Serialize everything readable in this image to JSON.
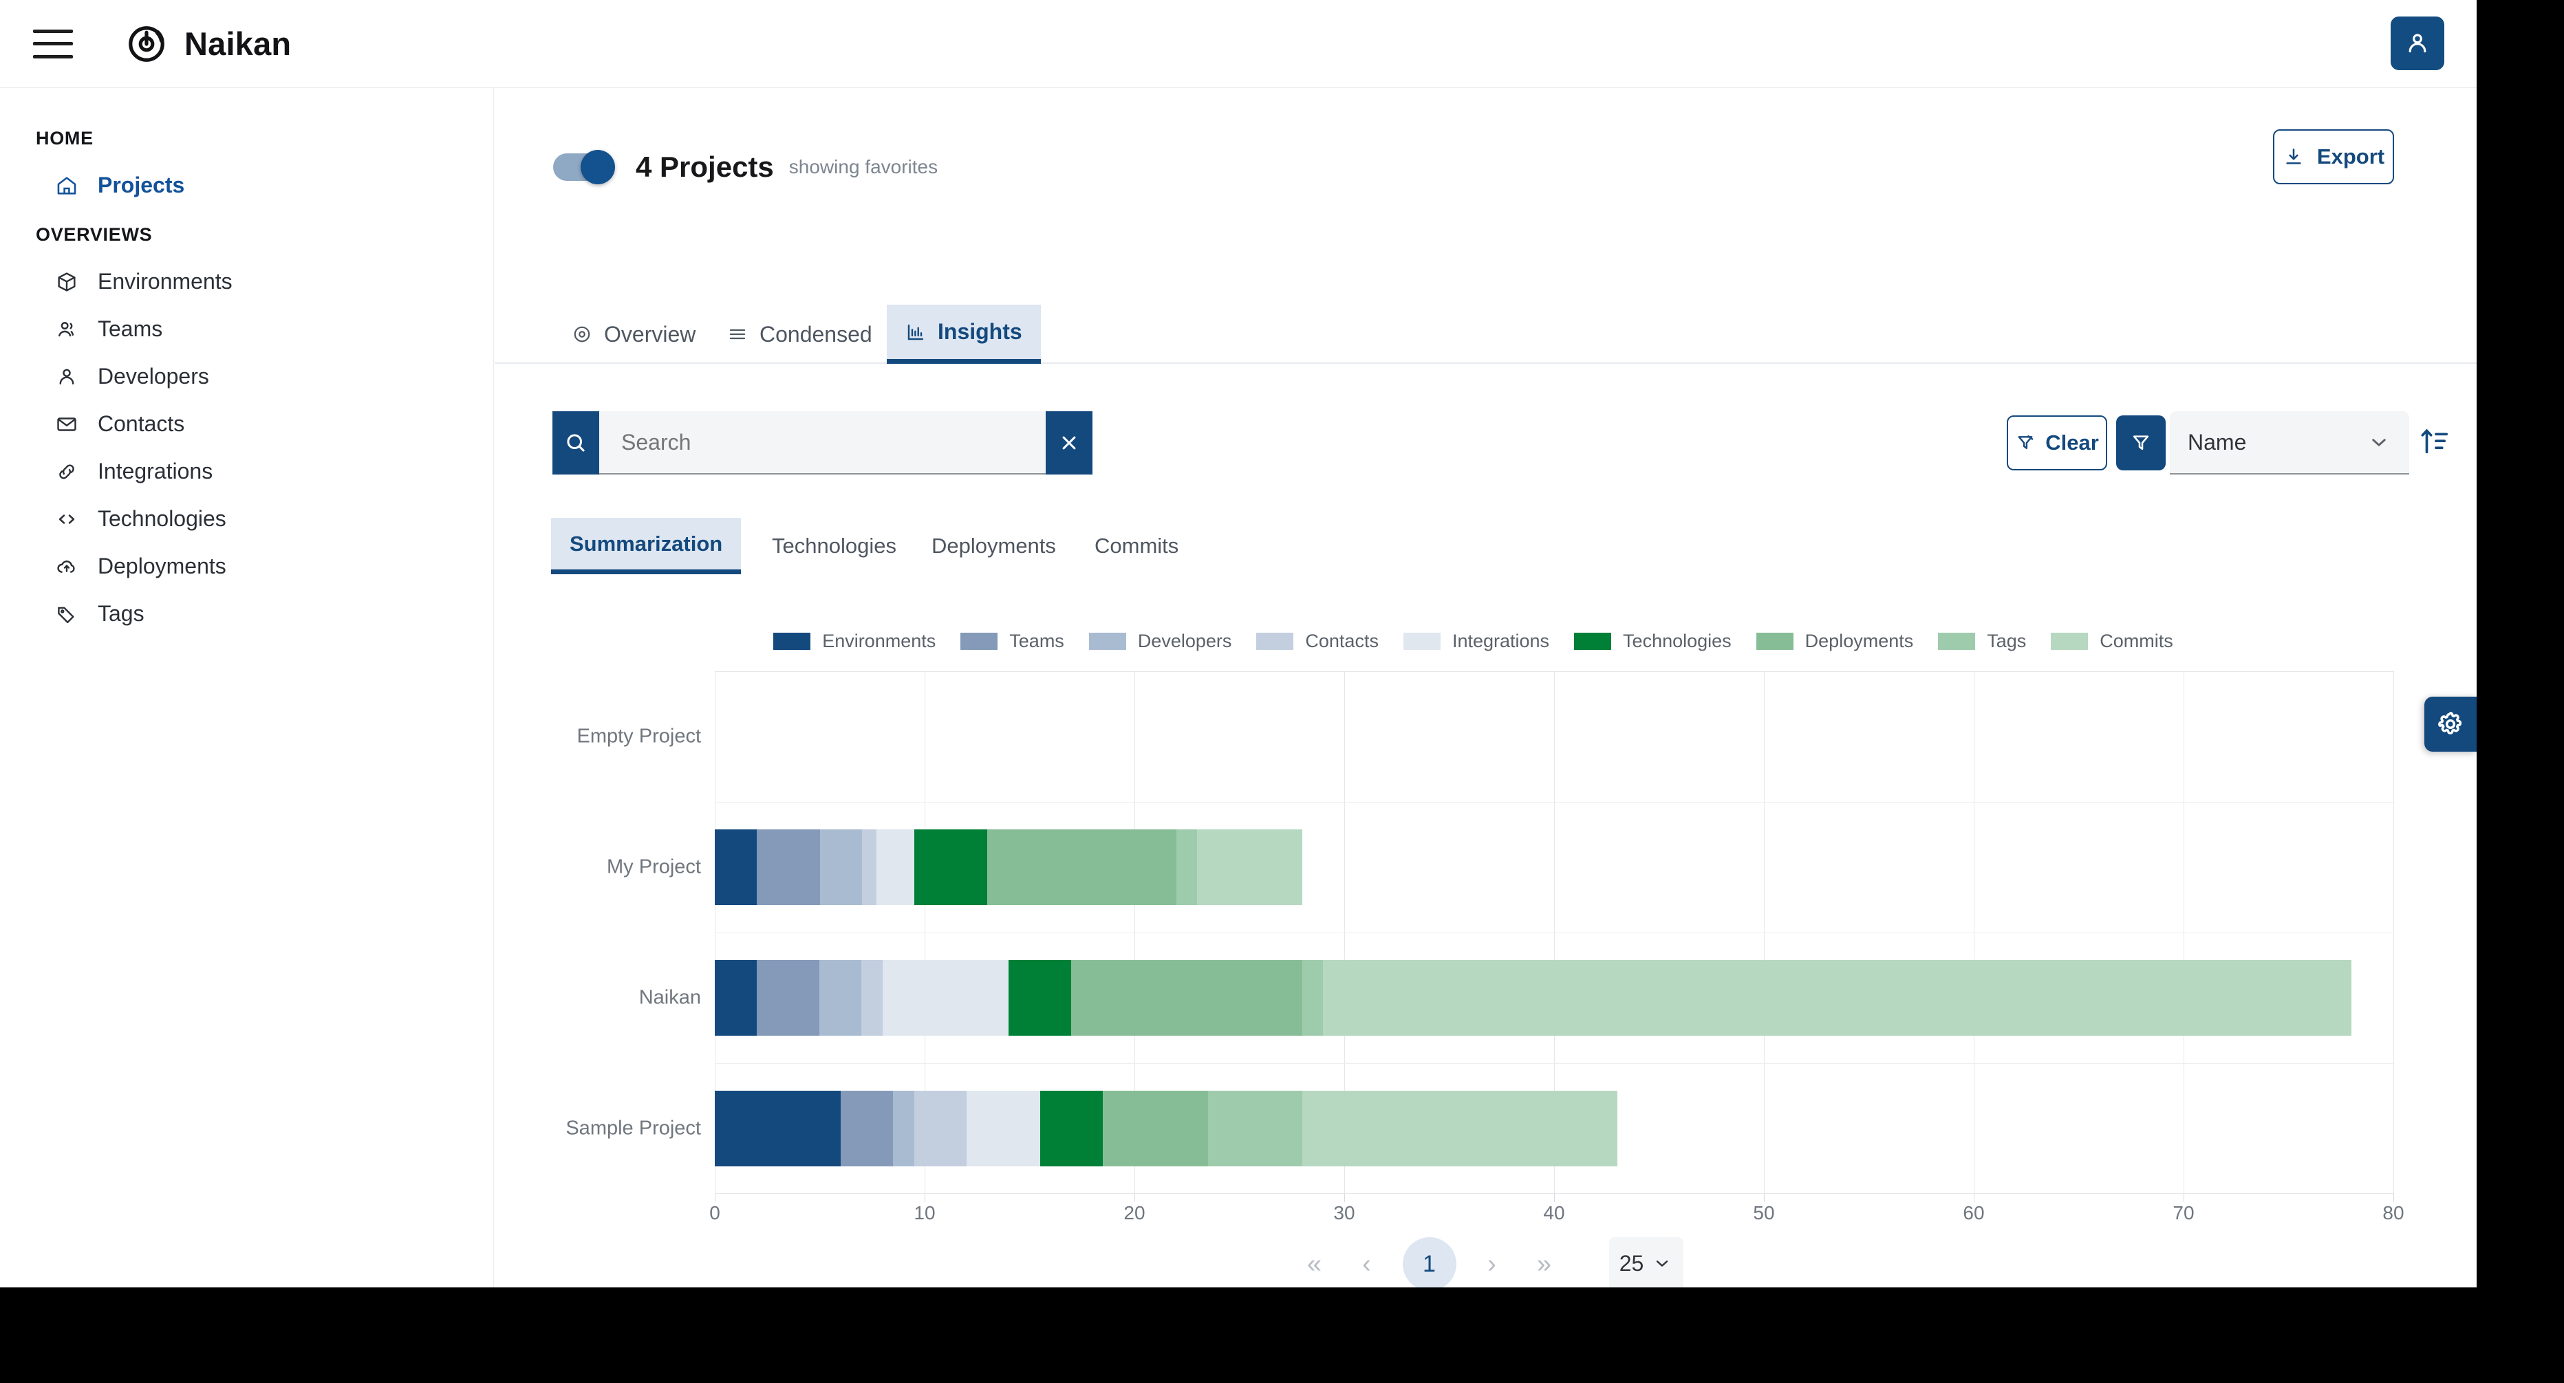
{
  "app": {
    "brand_name": "Naikan",
    "menu_icon": "hamburger-icon",
    "logo_icon": "naikan-logo-icon",
    "avatar_icon": "user-icon"
  },
  "sidebar": {
    "sections": [
      {
        "title": "HOME",
        "items": [
          {
            "label": "Projects",
            "icon": "home-icon",
            "active": true
          }
        ]
      },
      {
        "title": "OVERVIEWS",
        "items": [
          {
            "label": "Environments",
            "icon": "box-icon",
            "active": false
          },
          {
            "label": "Teams",
            "icon": "users-icon",
            "active": false
          },
          {
            "label": "Developers",
            "icon": "user-icon",
            "active": false
          },
          {
            "label": "Contacts",
            "icon": "mail-icon",
            "active": false
          },
          {
            "label": "Integrations",
            "icon": "link-icon",
            "active": false
          },
          {
            "label": "Technologies",
            "icon": "code-icon",
            "active": false
          },
          {
            "label": "Deployments",
            "icon": "cloud-upload-icon",
            "active": false
          },
          {
            "label": "Tags",
            "icon": "tag-icon",
            "active": false
          }
        ]
      }
    ]
  },
  "header": {
    "favorites_toggle_on": true,
    "title": "4 Projects",
    "subtitle": "showing favorites",
    "export_label": "Export",
    "export_icon": "download-icon"
  },
  "view_tabs": [
    {
      "label": "Overview",
      "icon": "eye-icon",
      "active": false
    },
    {
      "label": "Condensed",
      "icon": "list-icon",
      "active": false
    },
    {
      "label": "Insights",
      "icon": "bar-chart-icon",
      "active": true
    }
  ],
  "search": {
    "value": "",
    "placeholder": "Search",
    "search_icon": "search-icon",
    "clear_icon": "close-icon"
  },
  "controls": {
    "clear_label": "Clear",
    "clear_icon": "filter-off-icon",
    "filter_icon": "filter-icon",
    "sort_value": "Name",
    "sort_chevron_icon": "chevron-down-icon",
    "sort_direction_icon": "sort-ascending-icon"
  },
  "sub_tabs": [
    {
      "label": "Summarization",
      "active": true
    },
    {
      "label": "Technologies",
      "active": false
    },
    {
      "label": "Deployments",
      "active": false
    },
    {
      "label": "Commits",
      "active": false
    }
  ],
  "pagination": {
    "first_icon": "chevrons-left-icon",
    "prev_icon": "chevron-left-icon",
    "current_page": "1",
    "next_icon": "chevron-right-icon",
    "last_icon": "chevrons-right-icon",
    "page_size": "25",
    "page_size_chevron_icon": "chevron-down-icon"
  },
  "settings_fab": {
    "icon": "gear-icon"
  },
  "colors": {
    "primary": "#14497e",
    "accent_light": "#dde6f1",
    "surface": "#f4f5f6",
    "text": "#30343a",
    "muted": "#70767e"
  },
  "chart_data": {
    "type": "bar",
    "orientation": "horizontal",
    "stacked": true,
    "title": "",
    "xlabel": "",
    "ylabel": "",
    "xlim": [
      0,
      80
    ],
    "xticks": [
      0,
      10,
      20,
      30,
      40,
      50,
      60,
      70,
      80
    ],
    "grid": true,
    "legend_position": "top",
    "categories": [
      "Empty Project",
      "My Project",
      "Naikan",
      "Sample Project"
    ],
    "series": [
      {
        "name": "Environments",
        "color": "#14497e",
        "values": [
          0,
          2,
          2,
          6
        ]
      },
      {
        "name": "Teams",
        "color": "#849ab8",
        "values": [
          0,
          3,
          3,
          2.5
        ]
      },
      {
        "name": "Developers",
        "color": "#a9bbd1",
        "values": [
          0,
          2,
          2,
          1
        ]
      },
      {
        "name": "Contacts",
        "color": "#c3cfdf",
        "values": [
          0,
          0.7,
          1,
          2.5
        ]
      },
      {
        "name": "Integrations",
        "color": "#e0e7ef",
        "values": [
          0,
          1.8,
          6,
          3.5
        ]
      },
      {
        "name": "Technologies",
        "color": "#008037",
        "values": [
          0,
          3.5,
          3,
          3
        ]
      },
      {
        "name": "Deployments",
        "color": "#87bd96",
        "values": [
          0,
          9,
          11,
          5
        ]
      },
      {
        "name": "Tags",
        "color": "#9fcbad",
        "values": [
          0,
          1,
          1,
          4.5
        ]
      },
      {
        "name": "Commits",
        "color": "#b6d8c0",
        "values": [
          0,
          5,
          49,
          15
        ]
      }
    ]
  }
}
